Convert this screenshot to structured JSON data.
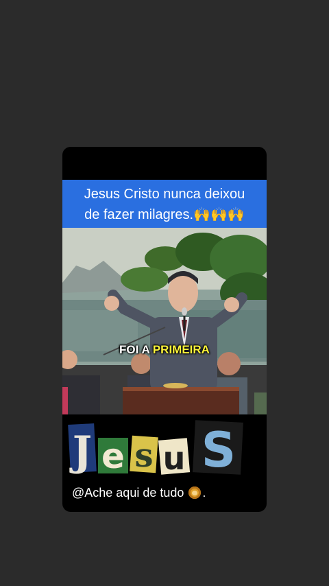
{
  "caption": {
    "line1": "Jesus Cristo nunca deixou",
    "line2": "de fazer milagres.🙌🙌🙌"
  },
  "video": {
    "subtitle_prefix": "FOI A ",
    "subtitle_highlight": "PRIMEIRA"
  },
  "sticker": {
    "letters": [
      "J",
      "e",
      "s",
      "u",
      "S"
    ]
  },
  "footer": {
    "handle": "@Ache aqui de tudo",
    "handle_suffix": ".",
    "emoji_icon": "lion-face-icon"
  },
  "colors": {
    "page_background": "#2b2b2b",
    "caption_background": "#2a6fe0",
    "subtitle_highlight": "#fff53a"
  }
}
